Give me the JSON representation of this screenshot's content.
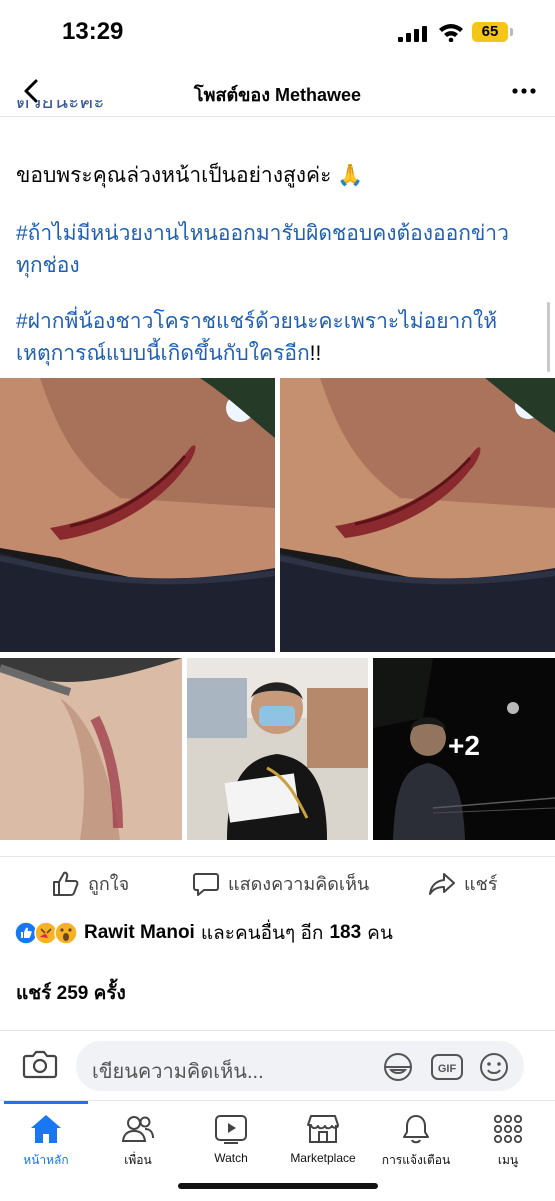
{
  "status_bar": {
    "time": "13:29",
    "battery": "65"
  },
  "header": {
    "title": "โพสต์ของ Methawee"
  },
  "post": {
    "cut_line": "ด้วยนะคะ",
    "thanks": "ขอบพระคุณล่วงหน้าเป็นอย่างสูงค่ะ 🙏",
    "tag1_line1": "#ถ้าไม่มีหน่วยงานไหนออกมารับผิดชอบคงต้องออกข่าว",
    "tag1_line2": "ทุกช่อง",
    "tag2_line1": "#ฝากพี่น้องชาวโคราชแชร์ด้วยนะคะเพราะไม่อยากให้",
    "tag2_line2": "เหตุการณ์แบบนี้เกิดขึ้นกับใครอีก",
    "tag2_end": "!!",
    "more_photos": "+2"
  },
  "actions": {
    "like": "ถูกใจ",
    "comment": "แสดงความคิดเห็น",
    "share": "แชร์"
  },
  "reactions": {
    "name": "Rawit Manoi",
    "rest_prefix": "และคนอื่นๆ อีก",
    "count": "183",
    "unit": "คน"
  },
  "shares": {
    "prefix": "แชร์",
    "count": "259",
    "unit": "ครั้ง"
  },
  "comment_box": {
    "placeholder": "เขียนความคิดเห็น...",
    "gif": "GIF"
  },
  "tabs": [
    {
      "label": "หน้าหลัก",
      "icon": "home-icon"
    },
    {
      "label": "เพื่อน",
      "icon": "friends-icon"
    },
    {
      "label": "Watch",
      "icon": "watch-icon"
    },
    {
      "label": "Marketplace",
      "icon": "marketplace-icon"
    },
    {
      "label": "การแจ้งเตือน",
      "icon": "bell-icon"
    },
    {
      "label": "เมนู",
      "icon": "menu-icon"
    }
  ],
  "colors": {
    "accent": "#1877f2",
    "hashtag": "#1f5fb4",
    "battery": "#f5c518"
  }
}
